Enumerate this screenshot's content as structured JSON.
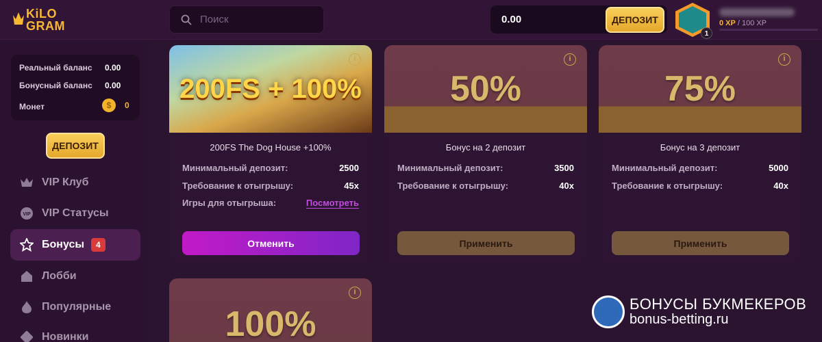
{
  "header": {
    "logo_line1": "KiLO",
    "logo_line2": "GRAM",
    "search_placeholder": "Поиск",
    "balance": "0.00",
    "deposit_label": "ДЕПОЗИТ",
    "level": "1",
    "xp_current": "0 XP",
    "xp_total": " / 100 XP"
  },
  "wallet": {
    "real_label": "Реальный баланс",
    "real_value": "0.00",
    "bonus_label": "Бонусный баланс",
    "bonus_value": "0.00",
    "coins_label": "Монет",
    "coins_value": "0",
    "coin_symbol": "$"
  },
  "sidebar": {
    "deposit_label": "ДЕПОЗИТ",
    "items": [
      {
        "label": "VIP Клуб"
      },
      {
        "label": "VIP Статусы"
      },
      {
        "label": "Бонусы",
        "badge": "4"
      },
      {
        "label": "Лобби"
      },
      {
        "label": "Популярные"
      },
      {
        "label": "Новинки"
      }
    ]
  },
  "cards": [
    {
      "banner": "200FS + 100%",
      "title": "200FS The Dog House +100%",
      "min_deposit_label": "Минимальный депозит:",
      "min_deposit_value": "2500",
      "wager_label": "Требование к отыгрышу:",
      "wager_value": "45x",
      "games_label": "Игры для отыгрыша:",
      "games_link": "Посмотреть",
      "button": "Отменить"
    },
    {
      "banner": "50%",
      "title": "Бонус на 2 депозит",
      "min_deposit_label": "Минимальный депозит:",
      "min_deposit_value": "3500",
      "wager_label": "Требование к отыгрышу:",
      "wager_value": "40x",
      "button": "Применить"
    },
    {
      "banner": "75%",
      "title": "Бонус на 3 депозит",
      "min_deposit_label": "Минимальный депозит:",
      "min_deposit_value": "5000",
      "wager_label": "Требование к отыгрышу:",
      "wager_value": "40x",
      "button": "Применить"
    },
    {
      "banner": "100%"
    }
  ],
  "watermark": {
    "line1": "БОНУСЫ БУКМЕКЕРОВ",
    "line2": "bonus-betting.ru"
  },
  "colors": {
    "accent_gold": "#f7b733",
    "active_nav": "#4b1f50",
    "cancel_gradient": "#c21ac7",
    "badge_red": "#d93a3a"
  }
}
